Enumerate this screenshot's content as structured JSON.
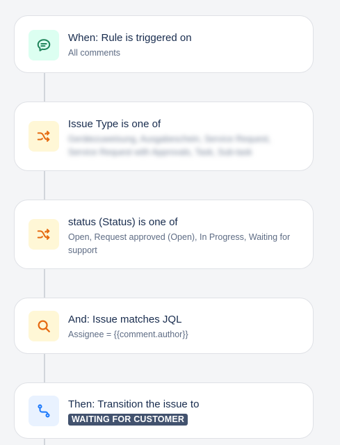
{
  "rule_steps": [
    {
      "title": "When: Rule is triggered on",
      "subtitle": "All comments",
      "icon": "comment-icon",
      "icon_bg": "#dcfff1",
      "icon_color": "#1f845a"
    },
    {
      "title": "Issue Type is one of",
      "subtitle": "Gerätezuweisung, Ausgabeschein, Service Request, Service Request with Approvals, Task, Sub-task",
      "subtitle_obscured": true,
      "icon": "shuffle-icon",
      "icon_bg": "#fff7d6",
      "icon_color": "#e56910"
    },
    {
      "title": "status (Status) is one of",
      "subtitle": "Open, Request approved (Open), In Progress, Waiting for support",
      "icon": "shuffle-icon",
      "icon_bg": "#fff7d6",
      "icon_color": "#e56910"
    },
    {
      "title": "And: Issue matches JQL",
      "subtitle": "Assignee = {{comment.author}}",
      "icon": "search-icon",
      "icon_bg": "#fff7d6",
      "icon_color": "#e56910"
    },
    {
      "title": "Then: Transition the issue to",
      "status_lozenge": "WAITING FOR CUSTOMER",
      "icon": "branch-icon",
      "icon_bg": "#e9f2ff",
      "icon_color": "#1d7afc"
    }
  ],
  "colors": {
    "canvas": "#f4f5f7",
    "card": "#ffffff",
    "connector": "#d1d5db",
    "lozenge_bg": "#42526e",
    "lozenge_text": "#ffffff"
  }
}
